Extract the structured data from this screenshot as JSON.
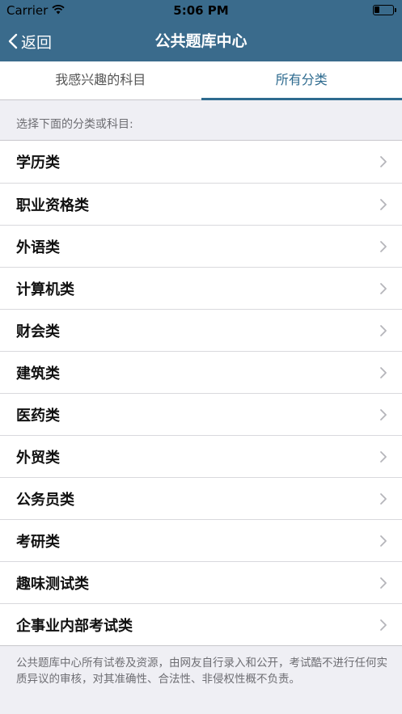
{
  "status_bar": {
    "carrier": "Carrier",
    "time": "5:06 PM",
    "battery_level": 0.3,
    "icons": [
      "wifi-icon",
      "battery-icon"
    ]
  },
  "nav": {
    "back_label": "返回",
    "title": "公共题库中心",
    "back_icon": "chevron-left-icon"
  },
  "tabs": [
    {
      "label": "我感兴趣的科目",
      "active": false
    },
    {
      "label": "所有分类",
      "active": true
    }
  ],
  "section_header": "选择下面的分类或科目:",
  "categories": [
    {
      "label": "学历类"
    },
    {
      "label": "职业资格类"
    },
    {
      "label": "外语类"
    },
    {
      "label": "计算机类"
    },
    {
      "label": "财会类"
    },
    {
      "label": "建筑类"
    },
    {
      "label": "医药类"
    },
    {
      "label": "外贸类"
    },
    {
      "label": "公务员类"
    },
    {
      "label": "考研类"
    },
    {
      "label": "趣味测试类"
    },
    {
      "label": "企事业内部考试类"
    }
  ],
  "footer_note": "公共题库中心所有试卷及资源，由网友自行录入和公开，考试酷不进行任何实质异议的审核，对其准确性、合法性、非侵权性概不负责。",
  "colors": {
    "nav_bg": "#3a6b8c",
    "accent": "#2e6b8f",
    "page_bg": "#efeff4"
  }
}
